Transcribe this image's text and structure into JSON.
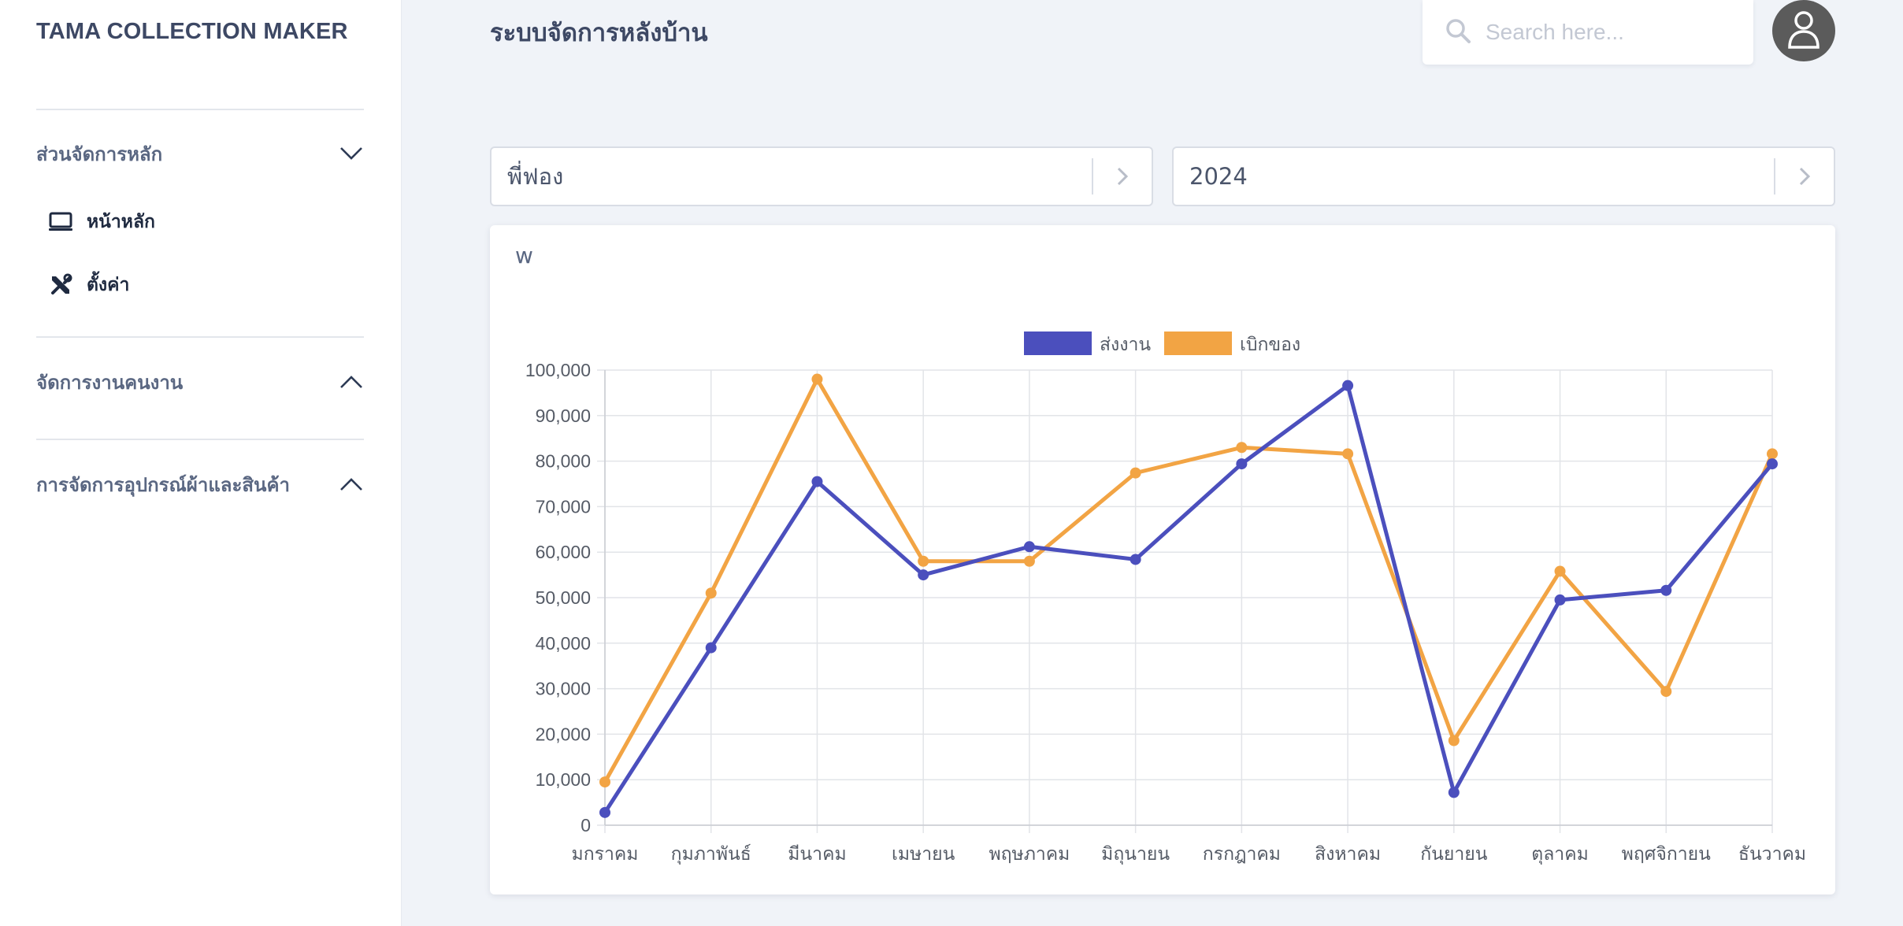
{
  "sidebar": {
    "brand": "TAMA COLLECTION MAKER",
    "sections": [
      {
        "label": "ส่วนจัดการหลัก",
        "expanded": true,
        "items": [
          {
            "label": "หน้าหลัก",
            "icon": "monitor-icon"
          },
          {
            "label": "ตั้งค่า",
            "icon": "tools-icon"
          }
        ]
      },
      {
        "label": "จัดการงานคนงาน",
        "expanded": false,
        "items": []
      },
      {
        "label": "การจัดการอุปกรณ์ผ้าและสินค้า",
        "expanded": false,
        "items": []
      }
    ]
  },
  "header": {
    "title": "ระบบจัดการหลังบ้าน",
    "search_placeholder": "Search here...",
    "search_icon": "search-icon",
    "avatar_icon": "user-icon"
  },
  "filters": {
    "worker": "พี่ฟอง",
    "year": "2024"
  },
  "card": {
    "title": "w"
  },
  "colors": {
    "series1": "#4b4fbd",
    "series2": "#f2a444",
    "grid": "#e2e4e8"
  },
  "chart_data": {
    "type": "line",
    "categories": [
      "มกราคม",
      "กุมภาพันธ์",
      "มีนาคม",
      "เมษายน",
      "พฤษภาคม",
      "มิถุนายน",
      "กรกฎาคม",
      "สิงหาคม",
      "กันยายน",
      "ตุลาคม",
      "พฤศจิกายน",
      "ธันวาคม"
    ],
    "series": [
      {
        "name": "ส่งงาน",
        "color": "#4b4fbd",
        "values": [
          2800,
          39000,
          75500,
          55000,
          61200,
          58400,
          79400,
          96600,
          7200,
          49500,
          51600,
          79400
        ]
      },
      {
        "name": "เบิกของ",
        "color": "#f2a444",
        "values": [
          9500,
          51000,
          98000,
          58000,
          58000,
          77400,
          83000,
          81600,
          18600,
          55800,
          29400,
          81600
        ]
      }
    ],
    "ylim": [
      0,
      100000
    ],
    "yticks": [
      "0",
      "10,000",
      "20,000",
      "30,000",
      "40,000",
      "50,000",
      "60,000",
      "70,000",
      "80,000",
      "90,000",
      "100,000"
    ],
    "grid": true,
    "legend": "top-center"
  }
}
